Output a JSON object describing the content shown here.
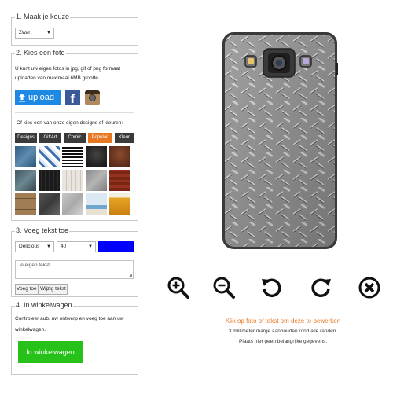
{
  "step1": {
    "legend": "1. Maak je keuze",
    "color_select": "Zwart"
  },
  "step2": {
    "legend": "2. Kies een foto",
    "desc_line1": "U kunt uw eigen fotos in jpg, gif of png formaat",
    "desc_line2": "uploaden van maximaal 6MB grootte.",
    "upload_label": "upload",
    "facebook_label": "f",
    "designs_text": "Of kies een van onze eigen designs of kleuren:",
    "tabs": [
      "Designs",
      "GiftArt",
      "Comic",
      "Populair",
      "Kleur"
    ],
    "active_tab": "Populair",
    "thumb_icons": [
      "blue-denim",
      "white-blue-mosaic",
      "black-white-stripes",
      "black-leather",
      "brown-leather",
      "blue-grey-texture",
      "black-pattern",
      "white-wood",
      "concrete-grey",
      "red-wood",
      "wooden-planks",
      "dark-grey-stone",
      "light-concrete",
      "beach-boat",
      "beer-foam"
    ]
  },
  "step3": {
    "legend": "3. Voeg tekst toe",
    "font_select": "Delicious",
    "size_select": "40",
    "text_color": "#0000ff",
    "text_placeholder": "Je eigen tekst",
    "add_button": "Voeg toe",
    "edit_button": "Wijzig tekst"
  },
  "step4": {
    "legend": "4. In winkelwagen",
    "desc_line1": "Controleer aub. uw ontwerp en voeg toe aan uw",
    "desc_line2": "winkelwagen.",
    "cart_button": "In winkelwagen",
    "cart_color": "#27c219"
  },
  "preview": {
    "phone_design": "diamond-plate-metal",
    "controls": [
      "zoom-in-icon",
      "zoom-out-icon",
      "rotate-left-icon",
      "rotate-right-icon",
      "delete-icon"
    ],
    "edit_hint": "Klik op foto of tekst om deze te bewerken",
    "margin_note": "3 millimeter marge aanhouden rond alle randen.",
    "important_note": "Plaats hier geen belangrijke gegevens."
  },
  "colors": {
    "accent_orange": "#e87722",
    "upload_blue": "#1e88e5",
    "facebook_blue": "#3b5998"
  }
}
